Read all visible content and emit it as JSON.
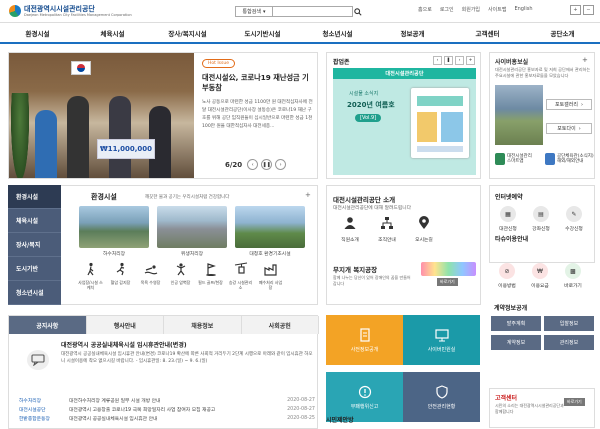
{
  "header": {
    "logo_title": "대전광역시시설관리공단",
    "logo_sub": "Daejeon Metropolitan City Facilities Management Corporation",
    "search_scope": "통합검색",
    "search_placeholder": "",
    "util": [
      "홈으로",
      "로그인",
      "회원가입",
      "사이트맵",
      "English"
    ],
    "font_plus": "+",
    "font_minus": "−"
  },
  "gnb": [
    "환경시설",
    "체육시설",
    "장사/복지시설",
    "도시기반시설",
    "청소년시설",
    "정보공개",
    "고객센터",
    "공단소개"
  ],
  "hero": {
    "badge": "Hot Issue",
    "title": "대전시설公, 코로나19 재난성금 기부동참",
    "desc": "노사 공동으로 마련한 성금 1100만 원 대전적십자사에 전달 대전시설관리공단(이사장 설동승)은 코로나19 재난 구호를 위해 공단 임직원들이 십시일반으로 마련한 성금 1천100만 원을 대한적십자사 대전세종...",
    "page": "6/20",
    "cheque": "₩11,000,000"
  },
  "popup": {
    "title": "팝업존",
    "header": "대전시설관리공단",
    "line1": "시설물 소식지",
    "line2": "2020년 여름호",
    "line3": "[Vol.9]"
  },
  "cyber": {
    "title": "사이버홍보실",
    "desc": "대전시설관리공단 홍보자료 및 저희 공단에서 관리하는 주요시설에 관한 홍보자료들을 모았습니다",
    "btn1": "포토갤러리",
    "btn2": "포토다이",
    "app1": [
      "대전시설관리",
      "스마트앱"
    ],
    "app2": [
      "공단체육관(소식지)",
      "해외/해외안내"
    ]
  },
  "lnb": [
    "환경시설",
    "체육시설",
    "장사/복지",
    "도시기반",
    "청소년시설"
  ],
  "facility": {
    "title": "환경시설",
    "sub": "깨끗한 물과 공기는 우리시설처럼 건강합니다",
    "photos": [
      "하수처리장",
      "위생처리장",
      "대청호 환경기초시설"
    ],
    "icons": [
      "사업장/시설 스케치",
      "혈압 감지장",
      "목욕 수영장",
      "인공 암벽장",
      "필드 골프/천장",
      "승강 시설관리소",
      "폐수처리 사업장"
    ]
  },
  "notice": {
    "tabs": [
      "공지사항",
      "행사안내",
      "채용정보",
      "사회공헌"
    ],
    "feat_title": "대전광역시 공공실내체육시설 임시휴관안내(변경)",
    "feat_desc": "대전광역시 공공실내체육시설 임시휴관 안내(변경) 코로나19 확산에 따른 사회적 거리두기 2단계 시행으로 아래와 같이 임시휴관 하오니 시설이용에 착오 없으시길 바랍니다. - 임시휴관일: 8. 23.(일) ~ 9. 6.(일)",
    "items": [
      {
        "cat": "하수처리장",
        "title": "대전하수처리장 계류공원 일부 시설 개방 안내",
        "date": "2020-08-27"
      },
      {
        "cat": "대전시설공단",
        "title": "대전광역시 고용창출 코로나19 극복 희망일자리 사업 참여자 모집 재공고",
        "date": "2020-08-27"
      },
      {
        "cat": "한밭종합운동장",
        "title": "대전광역시 공공실내체육시설 임시휴관 안내",
        "date": "2020-08-25"
      }
    ]
  },
  "life": {
    "title": "대전시설관리공단 소개",
    "sub": "대전시설관리공단에 대해 알려드립니다",
    "icons": [
      "직원소개",
      "조직안내",
      "오시는길"
    ],
    "free_title": "무지개 복지공장",
    "free_sub": "함께 나누는 당신이 있어 장애인의 꿈을 만들어갑니다",
    "free_btn": "바로가기"
  },
  "tiles": [
    "사전정보공개",
    "사이버민원실",
    "부패행위신고",
    "안전관리현황"
  ],
  "civil": "시민제안방",
  "rent": {
    "title": "인터넷예약",
    "items": [
      "대관신청",
      "강좌신청",
      "수강신청"
    ]
  },
  "tasu": {
    "title": "타슈이용안내",
    "items": [
      "이용방법",
      "이용요금",
      "바로가기"
    ]
  },
  "contract": {
    "title": "계약정보공개",
    "items": [
      "발주계획",
      "입찰정보",
      "계약정보",
      "관리정보"
    ]
  },
  "cust": {
    "title": "고객센터",
    "desc": "시민의 소리는 대전광역시시설관리공단과 함께합니다",
    "btn": "바로가기"
  }
}
